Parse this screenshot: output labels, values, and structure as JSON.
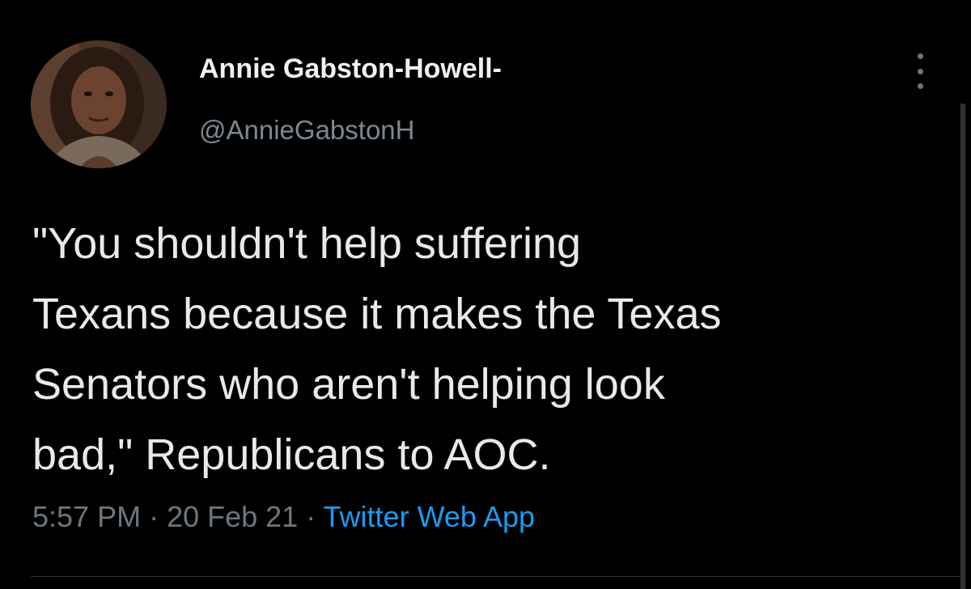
{
  "user": {
    "display_name": "Annie Gabston-Howell-",
    "handle": "@AnnieGabstonH"
  },
  "tweet": {
    "lines": [
      "\"You shouldn't help suffering",
      "Texans because it makes the Texas",
      "Senators who aren't helping look",
      "bad,\" Republicans to AOC."
    ],
    "time": "5:57 PM",
    "separator": " · ",
    "date": "20 Feb 21",
    "source": "Twitter Web App"
  },
  "icons": {
    "more": "more-vertical-icon",
    "avatar": "profile-photo"
  },
  "colors": {
    "background": "#000000",
    "text": "#e7e9ea",
    "muted": "#6e767d",
    "link": "#1d9bf0"
  }
}
